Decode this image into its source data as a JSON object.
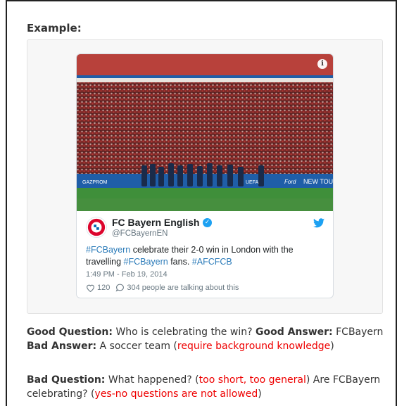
{
  "heading": "Example:",
  "tweet": {
    "info_icon_glyph": "i",
    "author_name": "FC Bayern English",
    "author_handle": "@FCBayernEN",
    "text_parts": [
      {
        "t": "#FCBayern",
        "hashtag": true
      },
      {
        "t": " celebrate their 2-0 win in London with the travelling ",
        "hashtag": false
      },
      {
        "t": "#FCBayern",
        "hashtag": true
      },
      {
        "t": " fans. ",
        "hashtag": false
      },
      {
        "t": "#AFCFCB",
        "hashtag": true
      }
    ],
    "timestamp": "1:49 PM - Feb 19, 2014",
    "likes": "120",
    "talking": "304 people are talking about this",
    "photo": {
      "ad_boards": [
        "GAZPROM",
        "UEFA",
        "Ford",
        "NEW TOU"
      ],
      "colors": {
        "crowd": "#8a2a2a",
        "pitch": "#3f8f3a",
        "board": "#1f5ea8",
        "roof": "#b8413b"
      }
    },
    "colors": {
      "hashtag": "#2b7bb9",
      "verified": "#1da1f2",
      "muted": "#697882"
    }
  },
  "explanation": {
    "p1": [
      {
        "t": "Good Question:",
        "style": "bold"
      },
      {
        "t": " Who is celebrating the win? ",
        "style": "plain"
      },
      {
        "t": "Good Answer:",
        "style": "bold"
      },
      {
        "t": " FCBayern ",
        "style": "plain"
      },
      {
        "t": "Bad Answer:",
        "style": "bold"
      },
      {
        "t": " A soccer team (",
        "style": "plain"
      },
      {
        "t": "require background knowledge",
        "style": "red"
      },
      {
        "t": ")",
        "style": "plain"
      }
    ],
    "p2": [
      {
        "t": "Bad Question:",
        "style": "bold"
      },
      {
        "t": " What happened? (",
        "style": "plain"
      },
      {
        "t": "too short, too general",
        "style": "red"
      },
      {
        "t": ") Are FCBayern celebrating? (",
        "style": "plain"
      },
      {
        "t": "yes-no questions are not allowed",
        "style": "red"
      },
      {
        "t": ")",
        "style": "plain"
      }
    ],
    "colors": {
      "red": "#ee0000"
    }
  }
}
